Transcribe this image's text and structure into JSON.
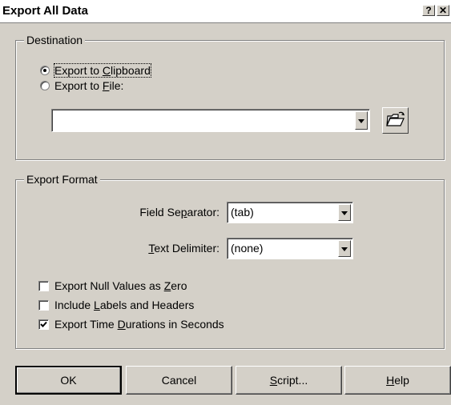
{
  "window": {
    "title": "Export All Data",
    "help_glyph": "?",
    "close_glyph": "✕"
  },
  "destination": {
    "legend": "Destination",
    "radio_clipboard": {
      "pre": "Export to ",
      "accel": "C",
      "post": "lipboard",
      "selected": true
    },
    "radio_file": {
      "pre": "Export to ",
      "accel": "F",
      "post": "ile:",
      "selected": false
    },
    "file_path": "",
    "browse_icon": "folder-open-icon"
  },
  "format": {
    "legend": "Export Format",
    "field_sep": {
      "pre": "Field Se",
      "accel": "p",
      "post": "arator:",
      "value": "(tab)"
    },
    "text_delim": {
      "pre": "",
      "accel": "T",
      "post": "ext Delimiter:",
      "value": "(none)"
    },
    "checks": [
      {
        "pre": "Export Null Values as ",
        "accel": "Z",
        "post": "ero",
        "checked": false
      },
      {
        "pre": "Include ",
        "accel": "L",
        "post": "abels and Headers",
        "checked": false
      },
      {
        "pre": "Export Time ",
        "accel": "D",
        "post": "urations in Seconds",
        "checked": true
      }
    ]
  },
  "buttons": {
    "ok": "OK",
    "cancel": "Cancel",
    "script": {
      "pre": "",
      "accel": "S",
      "post": "cript..."
    },
    "help": {
      "pre": "",
      "accel": "H",
      "post": "elp"
    }
  }
}
